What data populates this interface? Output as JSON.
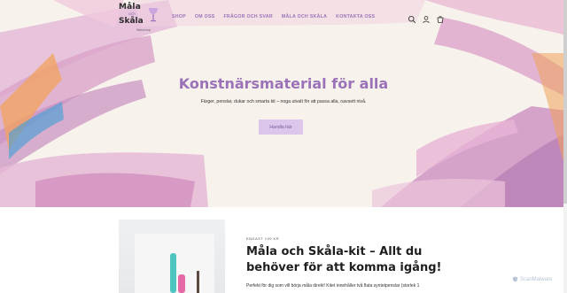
{
  "header": {
    "logo": {
      "line1": "Måla",
      "line2": "och",
      "line3": "Skåla",
      "line4": "Webshop"
    },
    "nav": [
      {
        "label": "SHOP"
      },
      {
        "label": "OM OSS"
      },
      {
        "label": "FRÅGOR OCH SVAR"
      },
      {
        "label": "MÅLA OCH SKÅLA"
      },
      {
        "label": "KONTAKTA OSS"
      }
    ],
    "icons": [
      "search-icon",
      "account-icon",
      "cart-icon"
    ]
  },
  "hero": {
    "title": "Konstnärsmaterial för alla",
    "subtitle": "Färger, penslar, dukar och smarta kit – noga utvalt för att passa alla, oavsett nivå.",
    "button_label": "Handla här"
  },
  "product": {
    "eyebrow": "ENDAST 199 KR",
    "title": "Måla och Skåla-kit – Allt du behöver för att komma igång!",
    "description": "Perfekt för dig som vill börja måla direkt! Kitet innehåller två flata syntetpenslar (storlek 1"
  },
  "watermark": "ScanMalware",
  "colors": {
    "accent": "#9b72b8",
    "button_bg": "#dcc6ec",
    "hero_bg": "#f7f3ec"
  }
}
